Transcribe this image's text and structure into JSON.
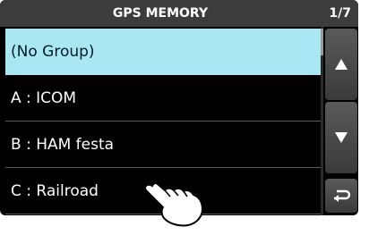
{
  "header": {
    "title": "GPS MEMORY",
    "page": "1/7"
  },
  "list": {
    "items": [
      {
        "label": "(No Group)",
        "selected": true
      },
      {
        "label": "A : ICOM"
      },
      {
        "label": "B : HAM festa"
      },
      {
        "label": "C : Railroad"
      }
    ]
  },
  "buttons": {
    "up_icon": "triangle-up-icon",
    "down_icon": "triangle-down-icon",
    "back_icon": "return-arrow-icon"
  },
  "colors": {
    "selected_bg": "#a9e8f3",
    "title_bg": "#3c3c3c",
    "screen_bg": "#000000"
  }
}
